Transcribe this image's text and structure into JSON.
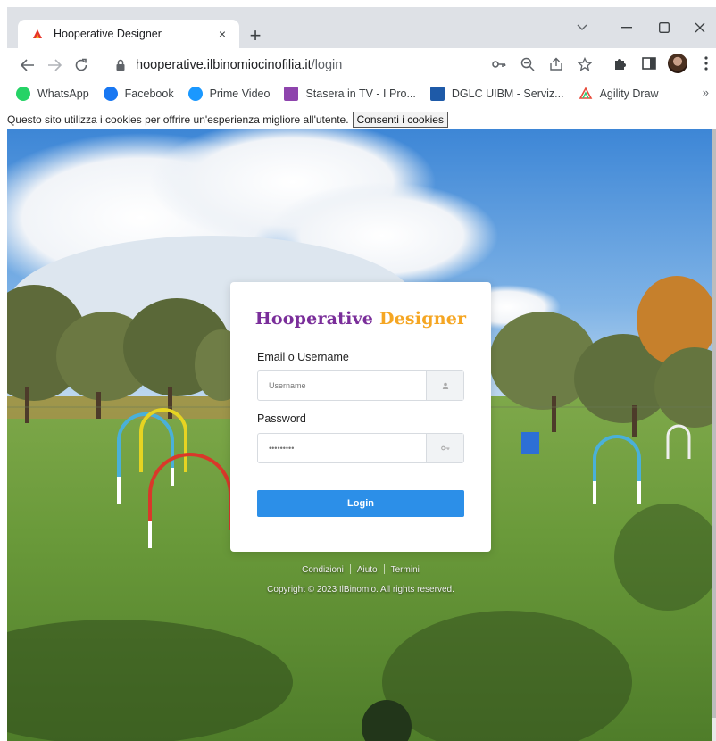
{
  "browser": {
    "tab_title": "Hooperative Designer",
    "tab_close": "×",
    "new_tab": "+",
    "url_host": "hooperative.ilbinomiocinofilia.it",
    "url_path": "/login",
    "icons": [
      "back-arrow",
      "forward-arrow",
      "reload",
      "lock",
      "key",
      "zoom",
      "share",
      "star",
      "extensions",
      "side-panel",
      "profile",
      "menu"
    ]
  },
  "bookmarks": [
    {
      "label": "WhatsApp",
      "color": "#25d366"
    },
    {
      "label": "Facebook",
      "color": "#1877f2"
    },
    {
      "label": "Prime Video",
      "color": "#1a98ff"
    },
    {
      "label": "Stasera in TV - I Pro...",
      "color": "#8e44ad"
    },
    {
      "label": "DGLC UIBM - Serviz...",
      "color": "#1e5aa8"
    },
    {
      "label": "Agility Draw",
      "color": "#e74c3c"
    }
  ],
  "bookmarks_more": "»",
  "cookie": {
    "message": "Questo sito utilizza i cookies per offrire un'esperienza migliore all'utente.",
    "button": "Consenti i cookies"
  },
  "login": {
    "logo_part1": "Hooperative",
    "logo_part2": "Designer",
    "email_label": "Email o Username",
    "email_placeholder": "Username",
    "password_label": "Password",
    "password_placeholder": "•••••••••",
    "button": "Login"
  },
  "footer": {
    "links": [
      "Condizioni",
      "Aiuto",
      "Termini"
    ],
    "copyright": "Copyright © 2023 IlBinomio. All rights reserved."
  },
  "colors": {
    "logo_purple": "#7a2e9a",
    "logo_orange": "#f5a623",
    "login_button": "#2c8fe8"
  }
}
